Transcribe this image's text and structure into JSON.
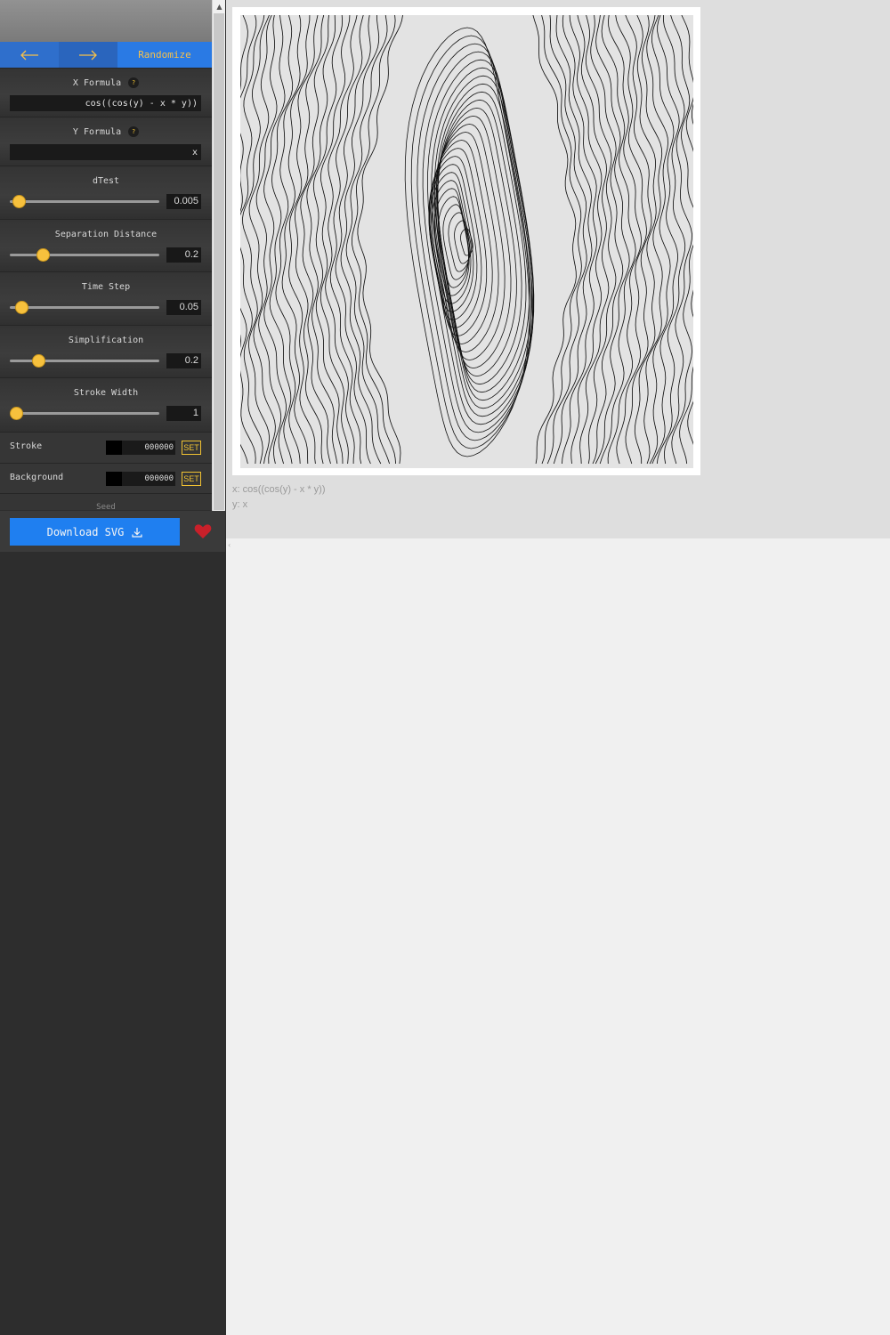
{
  "nav": {
    "randomize": "Randomize"
  },
  "x_formula": {
    "label": "X Formula",
    "help": "?",
    "value": "cos((cos(y) - x * y))"
  },
  "y_formula": {
    "label": "Y Formula",
    "help": "?",
    "value": "x"
  },
  "sliders": [
    {
      "label": "dTest",
      "value": "0.005",
      "fraction": 0.06
    },
    {
      "label": "Separation Distance",
      "value": "0.2",
      "fraction": 0.22
    },
    {
      "label": "Time Step",
      "value": "0.05",
      "fraction": 0.08
    },
    {
      "label": "Simplification",
      "value": "0.2",
      "fraction": 0.19
    },
    {
      "label": "Stroke Width",
      "value": "1",
      "fraction": 0.04
    }
  ],
  "stroke": {
    "label": "Stroke",
    "hex": "000000",
    "set": "SET",
    "color": "#000000"
  },
  "background": {
    "label": "Background",
    "hex": "000000",
    "set": "SET",
    "color": "#000000"
  },
  "seed": {
    "label": "Seed"
  },
  "download": {
    "label": "Download SVG"
  },
  "caption": {
    "x": "x: cos((cos(y) - x * y))",
    "y": "y: x"
  },
  "colors": {
    "accent": "#f7c13d",
    "button": "#1f7ff0",
    "heart": "#c9202a"
  }
}
